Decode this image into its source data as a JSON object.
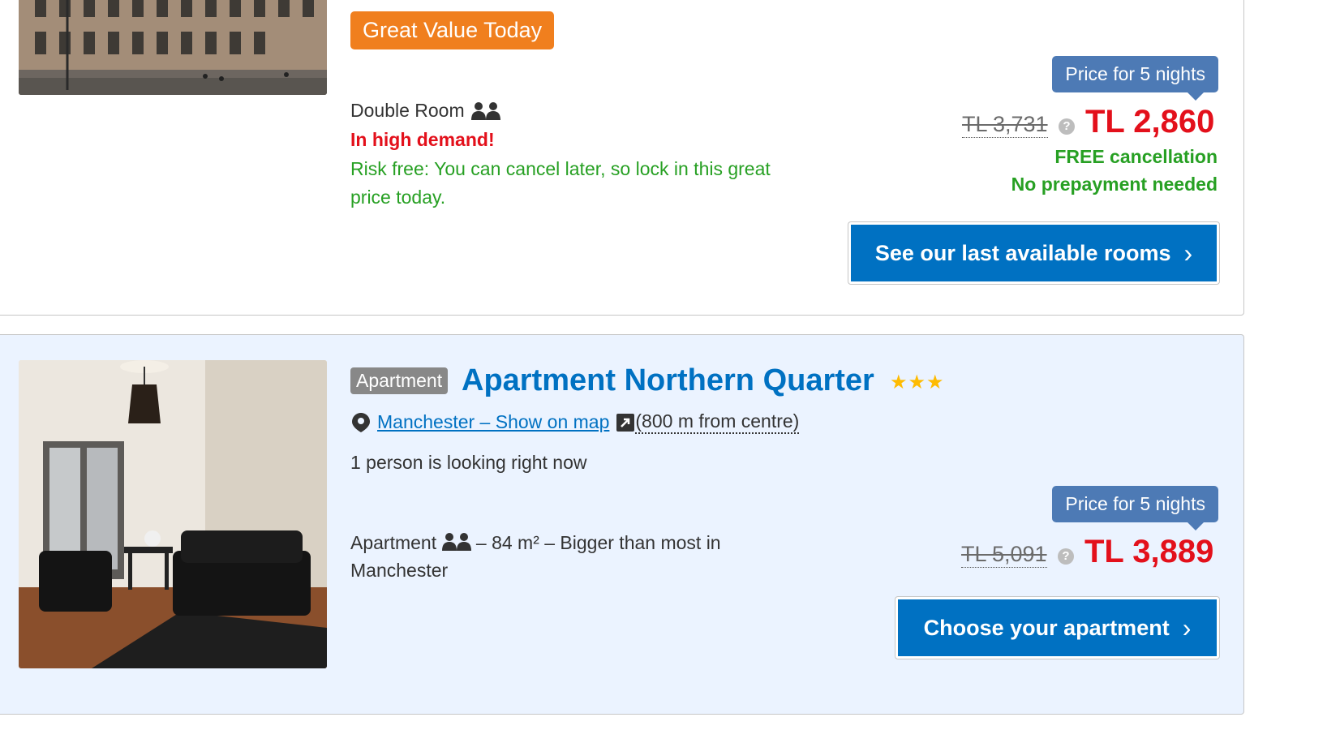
{
  "listing1": {
    "badge": "Great Value Today",
    "room_type": "Double Room",
    "demand": "In high demand!",
    "risk_free": "Risk free: You can cancel later, so lock in this great price today.",
    "price_tag": "Price for 5 nights",
    "old_price": "TL 3,731",
    "new_price": "TL 2,860",
    "free_cancellation": "FREE cancellation",
    "no_prepayment": "No prepayment needed",
    "cta": "See our last available rooms"
  },
  "listing2": {
    "type_badge": "Apartment",
    "name": "Apartment Northern Quarter",
    "stars": "★★★",
    "star_count": 3,
    "location_link": "Manchester – Show on map",
    "distance": "(800 m from centre)",
    "looking": "1 person is looking right now",
    "apt_prefix": "Apartment",
    "apt_suffix": "– 84 m² – Bigger than most in Manchester",
    "price_tag": "Price for 5 nights",
    "old_price": "TL 5,091",
    "new_price": "TL 3,889",
    "cta": "Choose your apartment"
  },
  "icons": {
    "help": "?",
    "chevron": "›"
  },
  "colors": {
    "accent_blue": "#0071c2",
    "orange_badge": "#f07f1e",
    "price_red": "#e3101b",
    "success_green": "#27a023",
    "price_tag_blue": "#4d7ab5",
    "star_yellow": "#febb02"
  }
}
